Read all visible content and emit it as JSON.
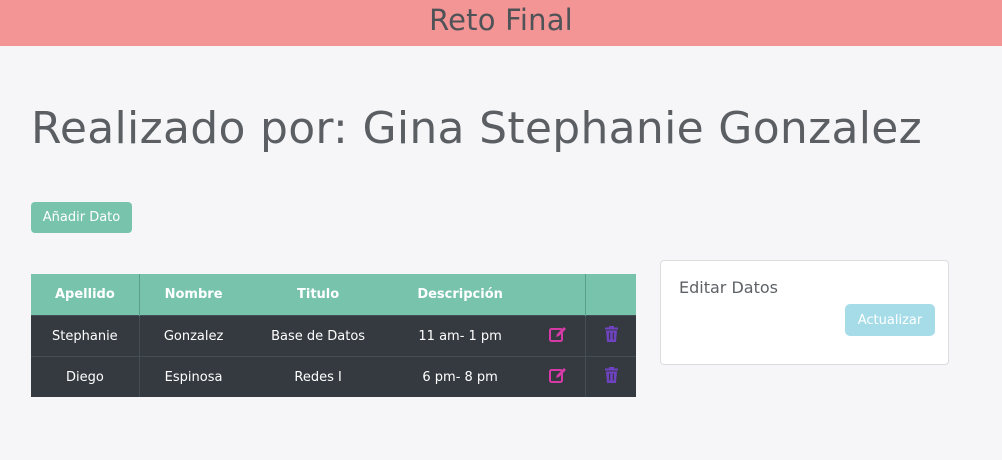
{
  "header": {
    "title": "Reto Final"
  },
  "page": {
    "heading": "Realizado por: Gina Stephanie Gonzalez"
  },
  "actions": {
    "add_label": "Añadir Dato"
  },
  "table": {
    "columns": [
      "Apellido",
      "Nombre",
      "Titulo",
      "Descripción"
    ],
    "rows": [
      [
        "Stephanie",
        "Gonzalez",
        "Base de Datos",
        "11 am- 1 pm"
      ],
      [
        "Diego",
        "Espinosa",
        "Redes I",
        "6 pm- 8 pm"
      ]
    ],
    "edit_icon": "edit-icon",
    "delete_icon": "trash-icon"
  },
  "edit_panel": {
    "title": "Editar Datos",
    "update_label": "Actualizar"
  },
  "colors": {
    "header_bg": "#f49595",
    "accent": "#77c3ab",
    "table_body_bg": "#343a40",
    "edit_icon": "#d63aa6",
    "delete_icon": "#6f42c1",
    "update_button": "#a6dce8"
  }
}
